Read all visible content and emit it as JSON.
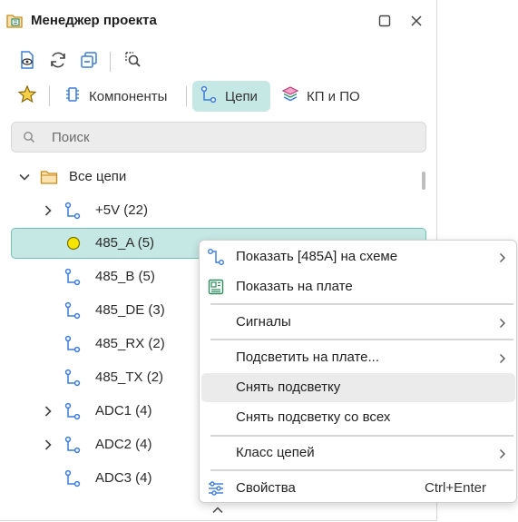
{
  "window": {
    "title": "Менеджер проекта",
    "icon": "project-manager-icon"
  },
  "toolbar": {
    "buttons": [
      "preview-icon",
      "refresh-icon",
      "collapse-icon",
      "find-icon"
    ]
  },
  "tabs": {
    "favorites_icon": "star-icon",
    "items": [
      {
        "label": "Компоненты",
        "icon": "component-icon"
      },
      {
        "label": "Цепи",
        "icon": "net-icon"
      },
      {
        "label": "КП и ПО",
        "icon": "layers-icon"
      }
    ],
    "active": "Цепи"
  },
  "search": {
    "placeholder": "Поиск"
  },
  "tree": {
    "root": {
      "label": "Все цепи",
      "expanded": true
    },
    "nets": [
      {
        "label": "+5V (22)",
        "expandable": true
      },
      {
        "label": "485_A (5)",
        "expandable": false,
        "selected": true,
        "highlight_color": "#f5e600"
      },
      {
        "label": "485_B (5)",
        "expandable": false
      },
      {
        "label": "485_DE (3)",
        "expandable": false
      },
      {
        "label": "485_RX (2)",
        "expandable": false
      },
      {
        "label": "485_TX (2)",
        "expandable": false
      },
      {
        "label": "ADC1 (4)",
        "expandable": true
      },
      {
        "label": "ADC2 (4)",
        "expandable": true
      },
      {
        "label": "ADC3 (4)",
        "expandable": false
      }
    ]
  },
  "context_menu": {
    "items": [
      {
        "label": "Показать [485A] на схеме",
        "icon": "schematic-icon",
        "submenu": true
      },
      {
        "label": "Показать на плате",
        "icon": "board-icon",
        "submenu": false
      },
      {
        "label": "Сигналы",
        "submenu": true
      },
      {
        "label": "Подсветить на плате...",
        "submenu": true
      },
      {
        "label": "Снять подсветку",
        "submenu": false,
        "hovered": true
      },
      {
        "label": "Снять подсветку со всех",
        "submenu": false
      },
      {
        "label": "Класс цепей",
        "submenu": true
      },
      {
        "label": "Свойства",
        "icon": "properties-icon",
        "shortcut": "Ctrl+Enter"
      }
    ]
  },
  "colors": {
    "accent": "#c6e8e4",
    "accent_border": "#6fc2b5",
    "icon_blue": "#3c7bd9"
  }
}
